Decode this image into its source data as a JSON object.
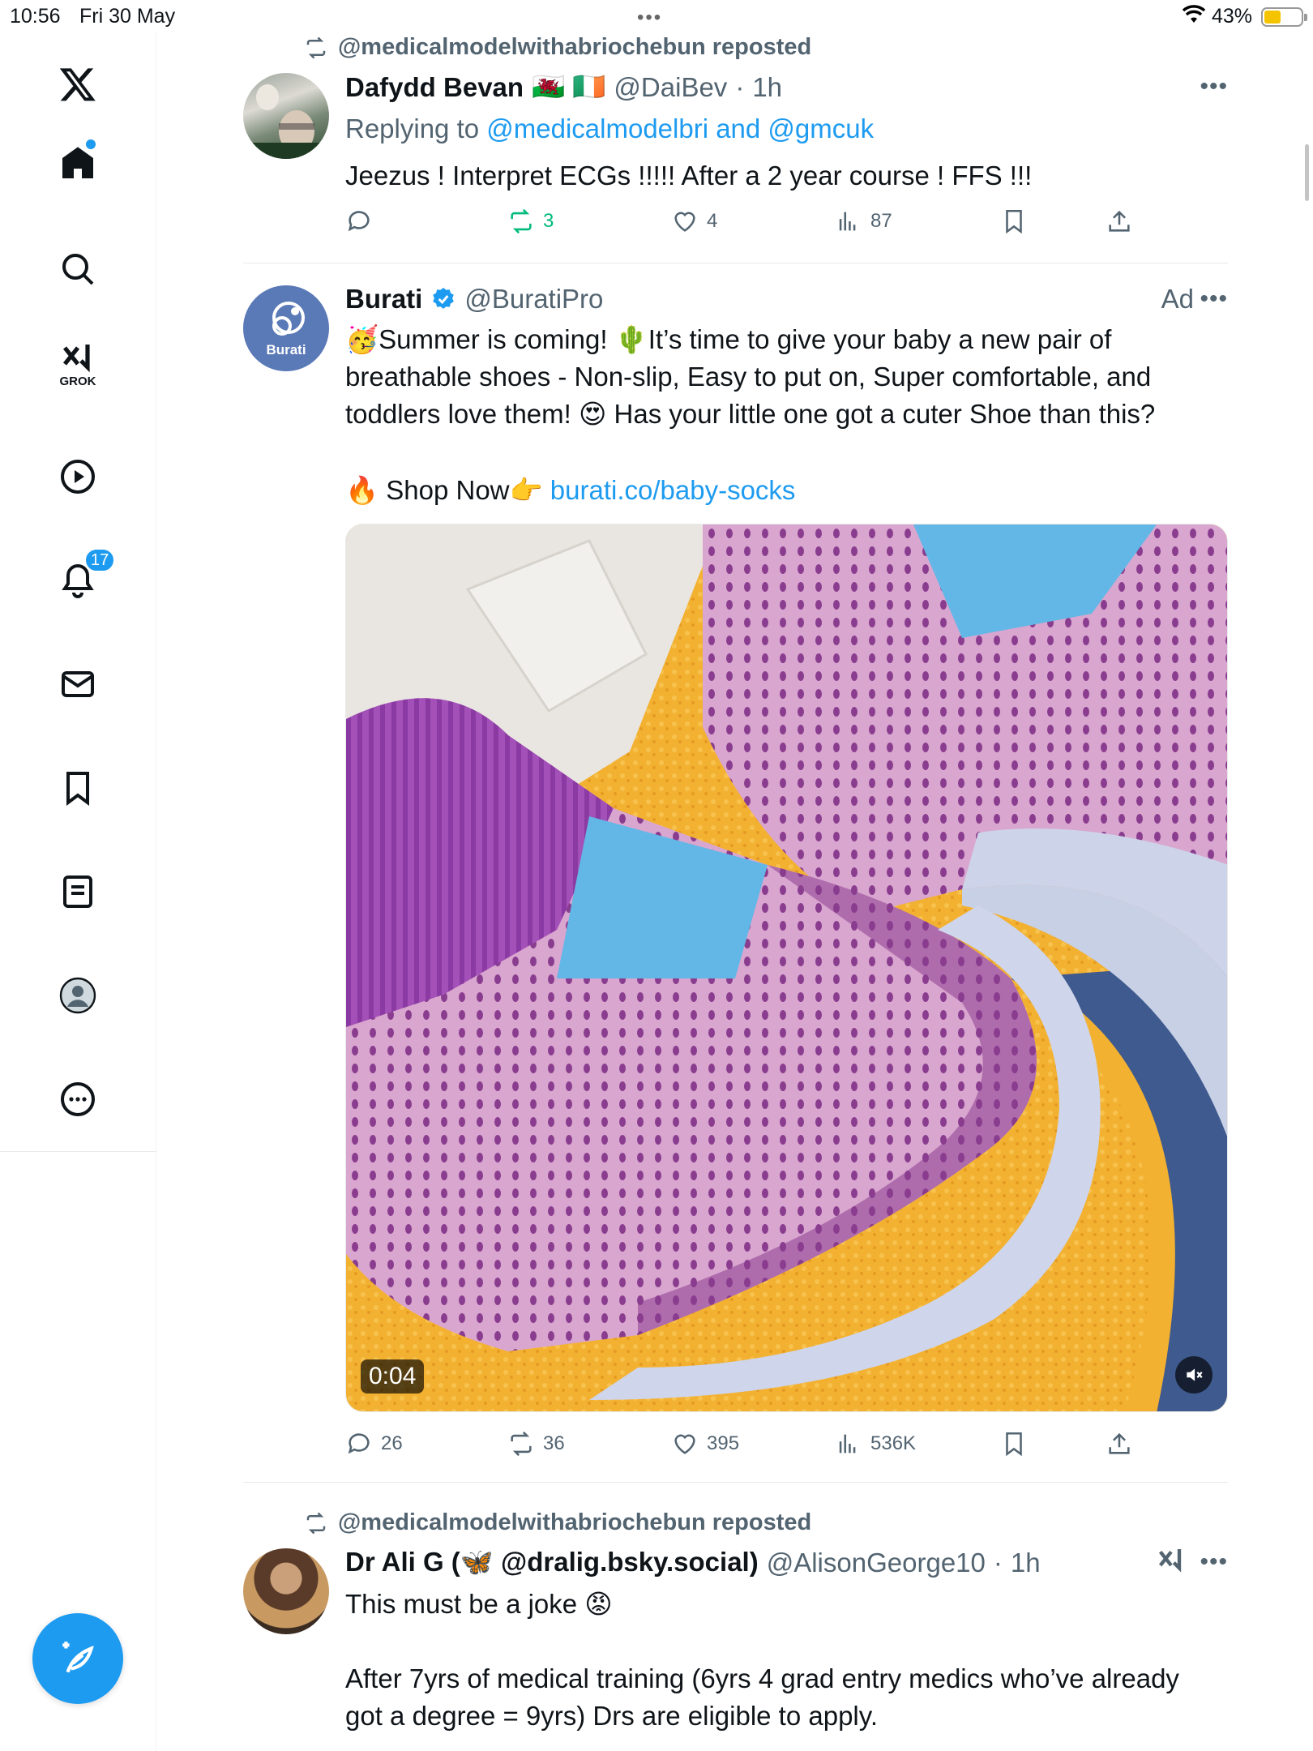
{
  "status": {
    "time": "10:56",
    "date": "Fri 30 May",
    "battery": "43%"
  },
  "sidebar": {
    "grok_label": "GROK",
    "notifications_count": "17"
  },
  "posts": [
    {
      "repost_by": "@medicalmodelwithabriochebun reposted",
      "name": "Dafydd Bevan",
      "flags": "🏴󠁧󠁢󠁷󠁬󠁳󠁿 🇮🇪",
      "handle": "@DaiBev",
      "time": "1h",
      "reply_prefix": "Replying to ",
      "reply_to": "@medicalmodelbri and @gmcuk",
      "text": "Jeezus ! Interpret ECGs !!!!! After a 2 year course ! FFS !!!",
      "replies": "",
      "reposts": "3",
      "likes": "4",
      "views": "87"
    },
    {
      "name": "Burati",
      "handle": "@BuratiPro",
      "ad_label": "Ad",
      "avatar_text": "Burati",
      "text1": "🥳Summer is coming! 🌵It’s time to give your baby a new pair of breathable shoes - Non-slip, Easy to put on, Super comfortable, and toddlers love them! 😍 Has your little one got a cuter Shoe than this?",
      "shop_text": "🔥 Shop Now👉 ",
      "shop_link": "burati.co/baby-socks",
      "video_time": "0:04",
      "replies": "26",
      "reposts": "36",
      "likes": "395",
      "views": "536K"
    },
    {
      "repost_by": "@medicalmodelwithabriochebun reposted",
      "name": "Dr Ali G (🦋 @dralig.bsky.social)",
      "handle": "@AlisonGeorge10",
      "time": "1h",
      "text1": "This must be a joke 😡",
      "text2": "After 7yrs of medical training (6yrs 4 grad entry medics who’ve already got a degree = 9yrs) Drs are eligible to apply."
    }
  ],
  "colors": {
    "accent": "#1d9bf0",
    "muted": "#536471",
    "repost_green": "#00ba7c"
  }
}
